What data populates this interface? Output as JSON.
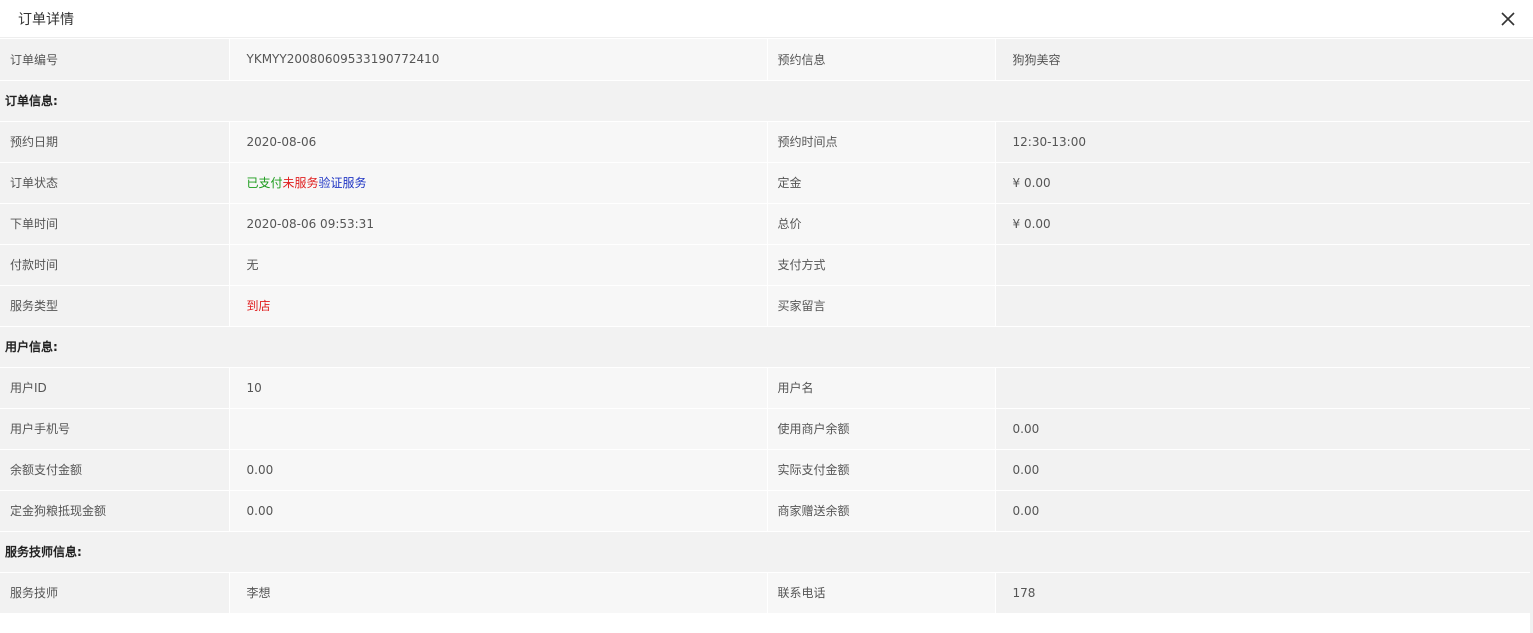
{
  "dialog": {
    "title": "订单详情",
    "close_icon": "close-icon"
  },
  "colors": {
    "status_paid": "#1a9b1a",
    "status_unserved": "#e02020",
    "status_verify": "#1f35c4",
    "service_type": "#e02020"
  },
  "order_no": {
    "label": "订单编号",
    "value": "YKMYY20080609533190772410",
    "label2": "预约信息",
    "value2": "狗狗美容"
  },
  "sections": {
    "order_info": "订单信息:",
    "user_info": "用户信息:",
    "tech_info": "服务技师信息:"
  },
  "order_rows": [
    {
      "label": "预约日期",
      "value": "2020-08-06",
      "label2": "预约时间点",
      "value2": "12:30-13:00"
    },
    {
      "label": "订单状态",
      "status_paid": "已支付",
      "status_unserved": "未服务",
      "status_verify": "验证服务",
      "label2": "定金",
      "value2": "¥ 0.00"
    },
    {
      "label": "下单时间",
      "value": "2020-08-06 09:53:31",
      "label2": "总价",
      "value2": "¥ 0.00"
    },
    {
      "label": "付款时间",
      "value": "无",
      "label2": "支付方式",
      "value2": ""
    },
    {
      "label": "服务类型",
      "value": "到店",
      "label2": "买家留言",
      "value2": ""
    }
  ],
  "user_rows": [
    {
      "label": "用户ID",
      "value": "10",
      "label2": "用户名",
      "value2": ""
    },
    {
      "label": "用户手机号",
      "value": "",
      "label2": "使用商户余额",
      "value2": "0.00"
    },
    {
      "label": "余额支付金额",
      "value": "0.00",
      "label2": "实际支付金额",
      "value2": "0.00"
    },
    {
      "label": "定金狗粮抵现金额",
      "value": "0.00",
      "label2": "商家赠送余额",
      "value2": "0.00"
    }
  ],
  "tech_rows": [
    {
      "label": "服务技师",
      "value": "李想",
      "label2": "联系电话",
      "value2": "178"
    }
  ]
}
